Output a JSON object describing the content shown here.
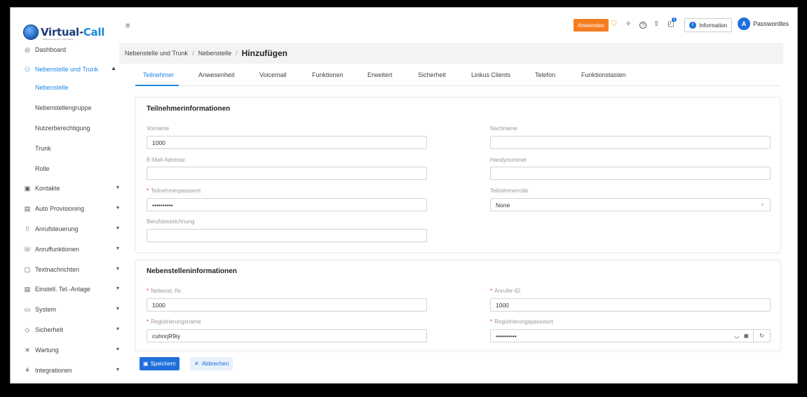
{
  "logo": {
    "part1": "Virtual-",
    "part2": "Call",
    "tagline": "Connect every time · everywhere"
  },
  "sidebar": {
    "items": [
      {
        "label": "Dashboard",
        "icon": "dashboard-icon",
        "glyph": "◎"
      },
      {
        "label": "Nebenstelle und Trunk",
        "icon": "users-icon",
        "glyph": "⚇",
        "chevron": "▲"
      },
      {
        "label": "Kontakte",
        "icon": "contacts-icon",
        "glyph": "▣",
        "chevron": "▾"
      },
      {
        "label": "Auto Provisioning",
        "icon": "provisioning-icon",
        "glyph": "▤",
        "chevron": "▾"
      },
      {
        "label": "Anrufsteuerung",
        "icon": "call-control-icon",
        "glyph": "⁞⁞",
        "chevron": "▾"
      },
      {
        "label": "Anruffunktionen",
        "icon": "phone-icon",
        "glyph": "☏",
        "chevron": "▾"
      },
      {
        "label": "Textnachrichten",
        "icon": "message-icon",
        "glyph": "▢",
        "chevron": "▾"
      },
      {
        "label": "Einstell. Tel.-Anlage",
        "icon": "settings-icon",
        "glyph": "▤",
        "chevron": "▾"
      },
      {
        "label": "System",
        "icon": "system-icon",
        "glyph": "▭",
        "chevron": "▾"
      },
      {
        "label": "Sicherheit",
        "icon": "shield-icon",
        "glyph": "◇",
        "chevron": "▾"
      },
      {
        "label": "Wartung",
        "icon": "wrench-icon",
        "glyph": "✕",
        "chevron": "▾"
      },
      {
        "label": "Integrationen",
        "icon": "integration-icon",
        "glyph": "⚘",
        "chevron": "▾"
      }
    ],
    "subitems": [
      "Nebenstelle",
      "Nebenstellengruppe",
      "Nutzerberechtigung",
      "Trunk",
      "Rolle"
    ]
  },
  "topbar": {
    "menu_icon": "≡",
    "apply_label": "Anwenden",
    "icons": [
      {
        "name": "shield-alert-icon",
        "glyph": "⛉",
        "color": "#f5a623"
      },
      {
        "name": "handshake-icon",
        "glyph": "✧",
        "color": "#444444"
      },
      {
        "name": "help-icon",
        "glyph": "?",
        "color": "#444444"
      },
      {
        "name": "cloud-upload-icon",
        "glyph": "⇧",
        "color": "#444444"
      },
      {
        "name": "notifications-icon",
        "glyph": "◰",
        "color": "#444444"
      }
    ],
    "notification_badge": "1",
    "info_label": "Information",
    "user_initial": "A",
    "user_name": "Passwordles"
  },
  "breadcrumb": {
    "items": [
      "Nebenstelle und Trunk",
      "Nebenstelle"
    ],
    "current": "Hinzufügen"
  },
  "tabs": [
    "Teilnehmer",
    "Anwesenheit",
    "Voicemail",
    "Funktionen",
    "Erweitert",
    "Sicherheit",
    "Linkus Clients",
    "Telefon",
    "Funktionstasten"
  ],
  "subscriber_card": {
    "title": "Teilnehmerinformationen",
    "first_name": {
      "label": "Vorname",
      "value": "1000"
    },
    "last_name": {
      "label": "Nachname",
      "value": ""
    },
    "email": {
      "label": "E-Mail-Adresse",
      "value": ""
    },
    "mobile": {
      "label": "Handynummer",
      "value": ""
    },
    "password": {
      "label": "Teilnehmerpasswort",
      "value": "••••••••••"
    },
    "role": {
      "label": "Teilnehmerrolle",
      "value": "None"
    },
    "job_title": {
      "label": "Berufsbezeichnung",
      "value": ""
    }
  },
  "extension_card": {
    "title": "Nebenstelleninformationen",
    "ext_number": {
      "label": "Nebenst.-Nr.",
      "value": "1000"
    },
    "caller_id": {
      "label": "Anrufer-ID",
      "value": "1000"
    },
    "reg_name": {
      "label": "Registrierungsname",
      "value": "cuhnrjR9iy"
    },
    "reg_password": {
      "label": "Registrierungspasswort",
      "value": "••••••••••"
    }
  },
  "actions": {
    "save_label": "Speichern",
    "cancel_label": "Abbrechen"
  },
  "colors": {
    "accent": "#1e88e5",
    "apply": "#f57c1f",
    "required": "#e53935"
  }
}
